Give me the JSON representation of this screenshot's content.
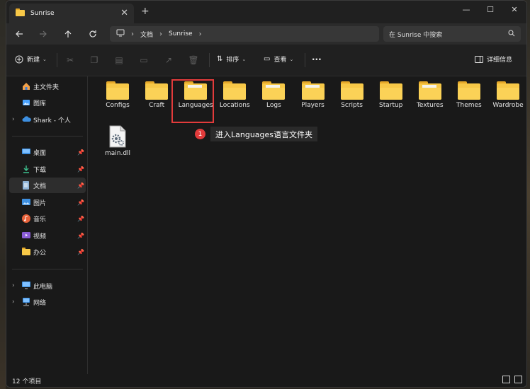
{
  "tab": {
    "title": "Sunrise",
    "new_tab": "+",
    "close": "✕"
  },
  "window_controls": {
    "minimize": "—",
    "maximize": "☐",
    "close": "✕"
  },
  "address": {
    "crumbs": [
      "文档",
      "Sunrise"
    ]
  },
  "search": {
    "placeholder": "在 Sunrise 中搜索"
  },
  "toolbar": {
    "new_label": "新建",
    "sort_label": "排序",
    "view_label": "查看",
    "more": "···",
    "details_label": "详细信息"
  },
  "sidebar": {
    "home": "主文件夹",
    "gallery": "图库",
    "onedrive": "Shark - 个人",
    "quick": [
      {
        "label": "桌面"
      },
      {
        "label": "下载"
      },
      {
        "label": "文档"
      },
      {
        "label": "图片"
      },
      {
        "label": "音乐"
      },
      {
        "label": "视频"
      },
      {
        "label": "办公"
      }
    ],
    "this_pc": "此电脑",
    "network": "网络"
  },
  "files": [
    {
      "name": "Configs",
      "type": "folder"
    },
    {
      "name": "Craft",
      "type": "folder"
    },
    {
      "name": "Languages",
      "type": "folder",
      "has_files": true
    },
    {
      "name": "Locations",
      "type": "folder"
    },
    {
      "name": "Logs",
      "type": "folder",
      "has_files": true
    },
    {
      "name": "Players",
      "type": "folder",
      "has_files": true
    },
    {
      "name": "Scripts",
      "type": "folder"
    },
    {
      "name": "Startup",
      "type": "folder"
    },
    {
      "name": "Textures",
      "type": "folder",
      "has_files": true
    },
    {
      "name": "Themes",
      "type": "folder"
    },
    {
      "name": "Wardrobe",
      "type": "folder"
    },
    {
      "name": "main.dll",
      "type": "dll"
    }
  ],
  "annotation": {
    "step": "1",
    "text": "进入Languages语言文件夹"
  },
  "status": {
    "items_count": "12 个项目"
  },
  "colors": {
    "folder": "#f7c847",
    "annotation": "#e23b3b",
    "accent_blue": "#4aa3ff"
  }
}
